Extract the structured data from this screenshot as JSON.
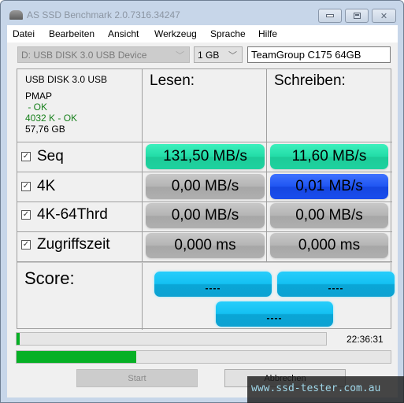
{
  "window": {
    "title": "AS SSD Benchmark 2.0.7316.34247",
    "icon": "drive-icon",
    "controls": [
      "minimize",
      "maximize",
      "close"
    ]
  },
  "menu": [
    "Datei",
    "Bearbeiten",
    "Ansicht",
    "Werkzeug",
    "Sprache",
    "Hilfe"
  ],
  "toolbar": {
    "drive": "D: USB DISK 3.0 USB Device",
    "size": "1 GB",
    "name": "TeamGroup C175 64GB"
  },
  "info": {
    "device": "USB DISK 3.0 USB",
    "driver": "PMAP",
    "driver_status": " - OK",
    "alignment": "4032 K - OK",
    "capacity": "57,76 GB"
  },
  "headers": {
    "read": "Lesen:",
    "write": "Schreiben:"
  },
  "rows": [
    {
      "label": "Seq",
      "checked": true,
      "read": "131,50 MB/s",
      "write": "11,60 MB/s",
      "read_color": "green",
      "write_color": "green"
    },
    {
      "label": "4K",
      "checked": true,
      "read": "0,00 MB/s",
      "write": "0,01 MB/s",
      "read_color": "gray",
      "write_color": "blue"
    },
    {
      "label": "4K-64Thrd",
      "checked": true,
      "read": "0,00 MB/s",
      "write": "0,00 MB/s",
      "read_color": "gray",
      "write_color": "gray"
    },
    {
      "label": "Zugriffszeit",
      "checked": true,
      "read": "0,000 ms",
      "write": "0,000 ms",
      "read_color": "gray",
      "write_color": "gray"
    }
  ],
  "score": {
    "label": "Score:",
    "read": "----",
    "write": "----",
    "total": "----"
  },
  "progress": {
    "current_percent": 1,
    "overall_percent": 32,
    "time": "22:36:31"
  },
  "buttons": {
    "start": "Start",
    "abort": "Abbrechen"
  },
  "watermark": "www.ssd-tester.com.au",
  "colors": {
    "green": "#22dca7",
    "gray": "#b4b4b4",
    "blue": "#1f55f2",
    "cyan": "#14c1f2",
    "progress": "#06b025",
    "ok_text": "#18801c"
  }
}
